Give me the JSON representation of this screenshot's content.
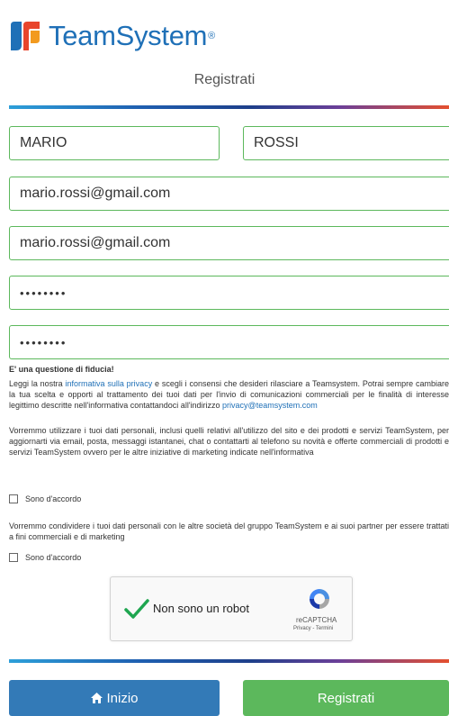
{
  "brand": {
    "name": "TeamSystem",
    "mark": "®"
  },
  "page": {
    "title": "Registrati"
  },
  "form": {
    "first_name": "MARIO",
    "last_name": "ROSSI",
    "email": "mario.rossi@gmail.com",
    "email_confirm": "mario.rossi@gmail.com",
    "password": "••••••••",
    "password_confirm": "••••••••"
  },
  "privacy": {
    "title": "E' una questione di fiducia!",
    "p1_before": "Leggi la nostra ",
    "p1_link": "informativa sulla privacy",
    "p1_mid": " e scegli i consensi che desideri rilasciare a Teamsystem. Potrai sempre cambiare la tua scelta e opporti al trattamento dei tuoi dati per l'invio di comunicazioni commerciali per le finalità di interesse legittimo descritte nell'informativa contattandoci all'indirizzo ",
    "p1_email": "privacy@teamsystem.com",
    "p2": "Vorremmo utilizzare i tuoi dati personali, inclusi quelli relativi all'utilizzo del sito e dei prodotti e servizi TeamSystem, per aggiornarti via email, posta, messaggi istantanei, chat o contattarti al telefono su novità e offerte commerciali di prodotti e servizi TeamSystem ovvero per le altre iniziative di marketing indicate nell'informativa",
    "consent1": "Sono d'accordo",
    "p3": "Vorremmo condividere i tuoi dati personali con le altre società del gruppo TeamSystem e ai suoi partner per essere trattati a fini commerciali e di marketing",
    "consent2": "Sono d'accordo"
  },
  "captcha": {
    "label": "Non sono un robot",
    "name": "reCAPTCHA",
    "links": "Privacy - Termini"
  },
  "buttons": {
    "home": "Inizio",
    "register": "Registrati"
  },
  "colors": {
    "brand": "#1f70b7",
    "valid_border": "#5cb85c",
    "home_btn": "#337ab7",
    "register_btn": "#5cb85c"
  }
}
